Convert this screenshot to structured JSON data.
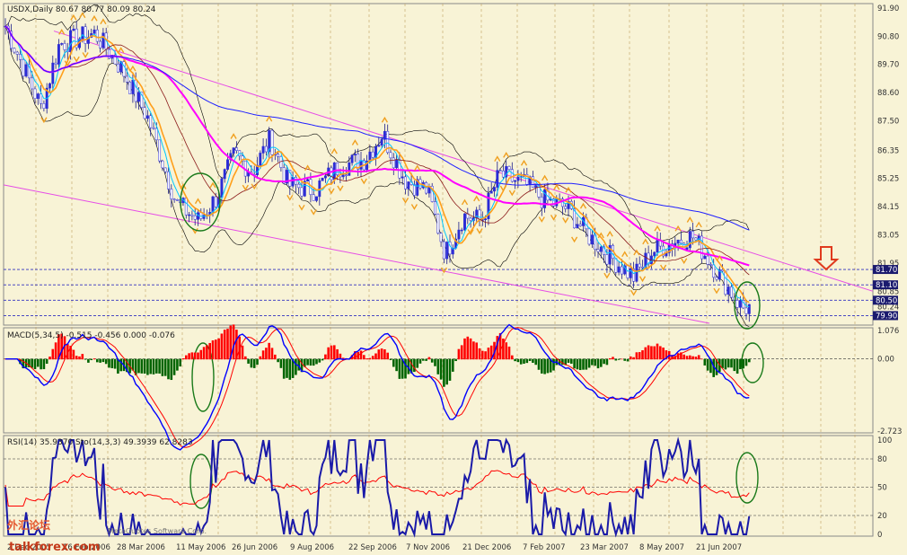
{
  "chart_data": [
    {
      "panel": "price",
      "type": "candlestick",
      "title": "USDX,Daily  80.67 80.77 80.09 80.24",
      "ohlc": {
        "open": 80.67,
        "high": 80.77,
        "low": 80.09,
        "close": 80.24
      },
      "ylim": [
        79.6,
        92.0
      ],
      "y_ticks": [
        "91.90",
        "90.80",
        "89.70",
        "88.60",
        "87.50",
        "86.35",
        "85.25",
        "84.15",
        "83.05",
        "81.95",
        "80.85",
        "80.24"
      ],
      "x_ticks": [
        "2 Dec 2005",
        "16 Feb 2006",
        "28 Mar 2006",
        "11 May 2006",
        "26 Jun 2006",
        "9 Aug 2006",
        "22 Sep 2006",
        "7 Nov 2006",
        "21 Dec 2006",
        "7 Feb 2007",
        "23 Mar 2007",
        "8 May 2007",
        "21 Jun 2007"
      ],
      "levels": [
        {
          "value": 81.7,
          "label": "81.70"
        },
        {
          "value": 81.1,
          "label": "81.10"
        },
        {
          "value": 80.5,
          "label": "80.50"
        },
        {
          "value": 79.9,
          "label": "79.90"
        }
      ],
      "close_series": {
        "x": [
          "2 Dec 2005",
          "16 Feb 2006",
          "28 Mar 2006",
          "11 May 2006",
          "26 Jun 2006",
          "9 Aug 2006",
          "22 Sep 2006",
          "7 Nov 2006",
          "21 Dec 2006",
          "7 Feb 2007",
          "23 Mar 2007",
          "8 May 2007",
          "21 Jun 2007"
        ],
        "values": [
          91.2,
          90.6,
          89.4,
          84.0,
          86.6,
          85.5,
          86.3,
          83.0,
          85.1,
          84.6,
          82.2,
          82.9,
          80.24
        ]
      },
      "colors": {
        "candle": "#2b2bd6",
        "ma_fast": "#ff9f1a",
        "ma_mid": "#ff00ff",
        "ma_slow": "#2020ff",
        "band": "#000000",
        "channel": "#e64de6"
      }
    },
    {
      "panel": "macd",
      "type": "line",
      "title": "MACD(5,34,5) -0.515 -0.456 0.000 -0.076",
      "ylim": [
        -2.723,
        1.076
      ],
      "y_ticks": [
        "1.076",
        "0.00",
        "-2.723"
      ],
      "values": {
        "macd": -0.515,
        "signal": -0.456,
        "zero": 0.0,
        "hist": -0.076
      },
      "colors": {
        "macd": "#0000ff",
        "signal": "#ff0000",
        "hist_pos": "#ff0000",
        "hist_neg": "#006400"
      }
    },
    {
      "panel": "oscillators",
      "type": "line",
      "title": "RSI(14) 35.9370  Sto(14,3,3) 49.3939 62.8283",
      "ylim": [
        0,
        100
      ],
      "y_ticks": [
        "100",
        "80",
        "50",
        "20",
        "0"
      ],
      "values": {
        "rsi": 35.937,
        "sto_k": 49.3939,
        "sto_d": 62.8283
      },
      "colors": {
        "rsi": "#ff0000",
        "sto": "#1a1aa8"
      }
    }
  ],
  "watermark": {
    "site_cn": "外汇论坛",
    "site": "talkforex.com",
    "copyright": "MetaQuotes Software Corp."
  }
}
